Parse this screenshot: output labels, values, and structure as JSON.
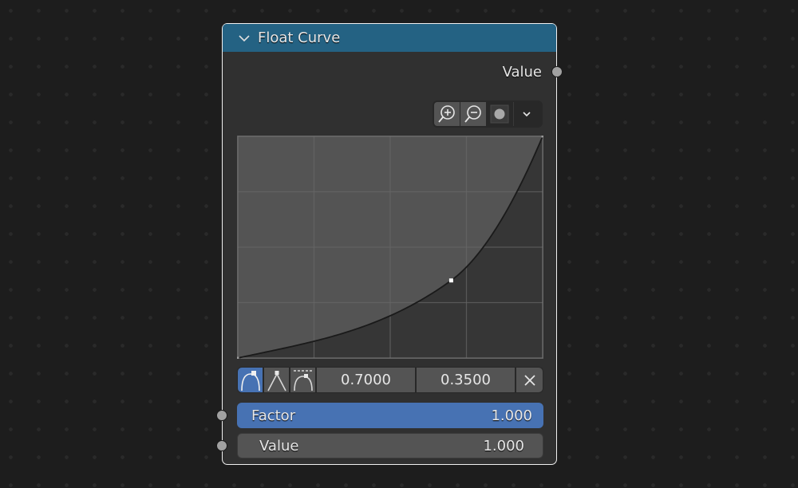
{
  "node": {
    "title": "Float Curve",
    "header_color": "#246283",
    "output_label": "Value",
    "toolbar": {
      "zoom_in_icon": "zoom-in-icon",
      "zoom_out_icon": "zoom-out-icon",
      "clip_icon": "clipping-dot-icon",
      "menu_icon": "chevron-down-icon"
    },
    "curve": {
      "points": [
        [
          0.0,
          0.0
        ],
        [
          0.7,
          0.35
        ],
        [
          1.0,
          1.0
        ]
      ],
      "selected_point_index": 1,
      "grid_divisions": 4
    },
    "handle_types": [
      {
        "name": "auto-handle",
        "active": true
      },
      {
        "name": "vector-handle",
        "active": false
      },
      {
        "name": "auto-clamped-handle",
        "active": false
      }
    ],
    "point_x": "0.7000",
    "point_y": "0.3500",
    "inputs": [
      {
        "label": "Factor",
        "value": "1.000"
      },
      {
        "label": "Value",
        "value": "1.000"
      }
    ],
    "accent_color": "#4772b3"
  }
}
